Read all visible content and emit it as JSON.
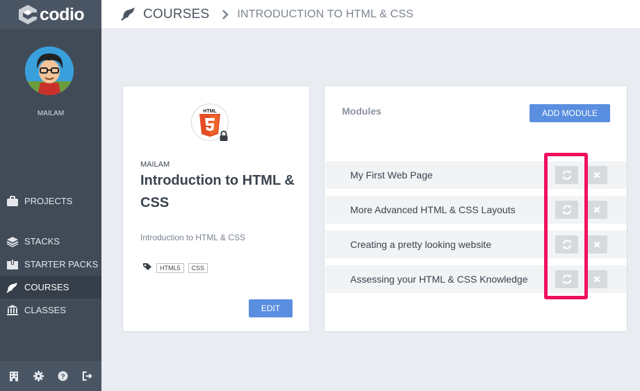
{
  "brand": {
    "name": "codio"
  },
  "user": {
    "name": "MAILAM"
  },
  "nav": {
    "items": [
      {
        "label": "PROJECTS",
        "icon": "briefcase-icon"
      },
      {
        "label": "STACKS",
        "icon": "layers-icon"
      },
      {
        "label": "STARTER PACKS",
        "icon": "package-icon"
      },
      {
        "label": "COURSES",
        "icon": "courses-icon",
        "active": true
      },
      {
        "label": "CLASSES",
        "icon": "institution-icon"
      }
    ]
  },
  "footer_icons": [
    "building-icon",
    "gear-icon",
    "help-icon",
    "logout-icon"
  ],
  "breadcrumb": {
    "root": "COURSES",
    "current": "INTRODUCTION TO HTML & CSS"
  },
  "course": {
    "owner": "MAILAM",
    "title": "Introduction to HTML & CSS",
    "description": "Introduction to HTML & CSS",
    "tags": [
      "HTML5",
      "CSS"
    ],
    "edit_label": "EDIT",
    "icon": "html5-icon",
    "html5_text": "HTML"
  },
  "modules": {
    "title": "Modules",
    "add_label": "ADD MODULE",
    "items": [
      {
        "name": "My First Web Page"
      },
      {
        "name": "More Advanced HTML & CSS Layouts"
      },
      {
        "name": "Creating a pretty looking website"
      },
      {
        "name": "Assessing your HTML & CSS Knowledge"
      }
    ]
  },
  "colors": {
    "accent": "#5a8fe0",
    "sidebar": "#414b57",
    "highlight": "#f0105f",
    "html5_orange": "#e44d26"
  }
}
